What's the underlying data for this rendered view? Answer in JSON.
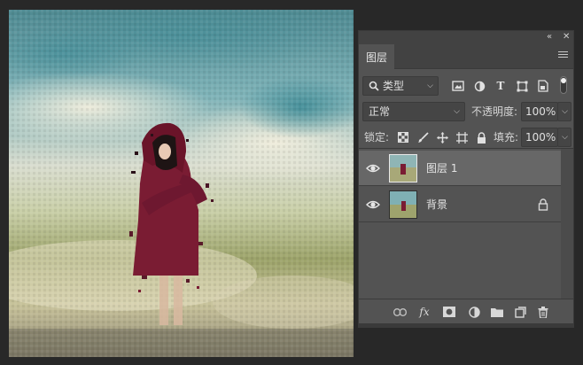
{
  "panel": {
    "topbar": {
      "collapse_icon": "double-chevron-icon",
      "close_icon": "close-icon"
    },
    "tab_label": "图层",
    "filter": {
      "kind_label": "类型",
      "icons": [
        "image-filter-icon",
        "adjustment-filter-icon",
        "type-filter-icon",
        "shape-filter-icon",
        "smart-object-filter-icon",
        "filter-toggle-icon"
      ]
    },
    "blend": {
      "mode_value": "正常",
      "opacity_label": "不透明度:",
      "opacity_value": "100%"
    },
    "lock": {
      "label": "锁定:",
      "fill_label": "填充:",
      "fill_value": "100%"
    },
    "layers": [
      {
        "name": "图层 1",
        "selected": true,
        "locked": false
      },
      {
        "name": "背景",
        "selected": false,
        "locked": true
      }
    ],
    "bottom_icons": [
      "link-layers-icon",
      "fx-icon",
      "mask-icon",
      "adjustment-layer-icon",
      "group-folder-icon",
      "new-layer-icon",
      "trash-icon"
    ],
    "fx_label": "fx"
  },
  "colors": {
    "panel_bg": "#535353",
    "selected_row": "#676767",
    "app_bg": "#282828",
    "dress": "#7a1c33"
  }
}
